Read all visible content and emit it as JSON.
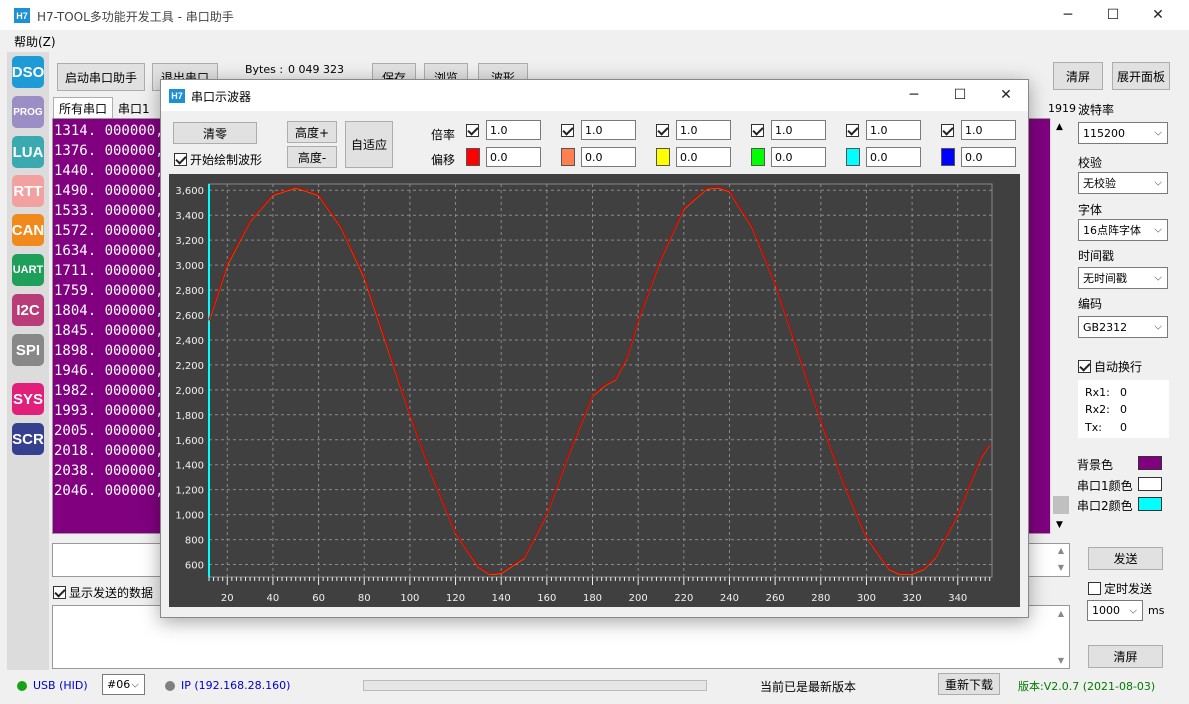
{
  "app": {
    "logo": "H7",
    "title": "H7-TOOL多功能开发工具 - 串口助手",
    "menu": "帮助(Z)"
  },
  "side_icons": [
    {
      "label": "DSO",
      "color": "#1e9ad6",
      "icon": "oscilloscope-icon"
    },
    {
      "label": "PROG",
      "color": "#9b8ec4",
      "icon": "programmer-icon"
    },
    {
      "label": "LUA",
      "color": "#3aa9b0",
      "icon": "lua-icon"
    },
    {
      "label": "RTT",
      "color": "#f2a0a0",
      "icon": "rtt-icon"
    },
    {
      "label": "CAN",
      "color": "#f08a1d",
      "icon": "can-icon"
    },
    {
      "label": "UART",
      "color": "#1ea05a",
      "icon": "uart-icon"
    },
    {
      "label": "I2C",
      "color": "#b83c78",
      "icon": "i2c-icon"
    },
    {
      "label": "SPI",
      "color": "#888888",
      "icon": "spi-icon"
    },
    {
      "label": "SYS",
      "color": "#e0207a",
      "icon": "sys-icon"
    },
    {
      "label": "SCR",
      "color": "#35408f",
      "icon": "scr-icon"
    }
  ],
  "toolbar": {
    "start": "启动串口助手",
    "exit": "退出串口",
    "bytes_label": "Bytes :",
    "bytes_value": "0 049 323",
    "save": "保存",
    "browse": "浏览",
    "wave": "波形",
    "clear": "清屏",
    "expand": "展开面板"
  },
  "tabs": {
    "all": "所有串口",
    "port1": "串口1"
  },
  "receive": {
    "count_right": "1919",
    "lines": [
      "1314. 000000,",
      "1376. 000000,",
      "1440. 000000,",
      "1490. 000000,",
      "1533. 000000,",
      "1572. 000000,",
      "1634. 000000,",
      "1711. 000000,",
      "1759. 000000,",
      "1804. 000000,",
      "1845. 000000,",
      "1898. 000000,",
      "1946. 000000,",
      "1982. 000000,",
      "1993. 000000,",
      "2005. 000000,",
      "2018. 000000,",
      "2038. 000000,",
      "2046. 000000,"
    ]
  },
  "settings": {
    "baud_label": "波特率",
    "baud": "115200",
    "parity_label": "校验",
    "parity": "无校验",
    "font_label": "字体",
    "font": "16点阵字体",
    "timestamp_label": "时间戳",
    "timestamp": "无时间戳",
    "encoding_label": "编码",
    "encoding": "GB2312",
    "autowrap": "自动换行",
    "rx1_label": "Rx1:",
    "rx1": "0",
    "rx2_label": "Rx2:",
    "rx2": "0",
    "tx_label": "Tx:",
    "tx": "0",
    "bg_color_label": "背景色",
    "bg_color": "#800080",
    "port1_color_label": "串口1颜色",
    "port1_color": "#ffffff",
    "port2_color_label": "串口2颜色",
    "port2_color": "#00ffff"
  },
  "send": {
    "send_button": "发送",
    "timed_send": "定时发送",
    "interval": "1000",
    "interval_unit": "ms",
    "show_sent": "显示发送的数据",
    "clear": "清屏"
  },
  "status": {
    "usb": "USB (HID)",
    "device": "#06",
    "ip": "IP (192.168.28.160)",
    "update_msg": "当前已是最新版本",
    "redownload": "重新下载",
    "version": "版本:V2.0.7 (2021-08-03)"
  },
  "scope": {
    "logo": "H7",
    "title": "串口示波器",
    "clear": "清零",
    "height_plus": "高度+",
    "height_minus": "高度-",
    "auto_fit": "自适应",
    "start_draw": "开始绘制波形",
    "scale_label": "倍率",
    "offset_label": "偏移",
    "channels": [
      {
        "scale": "1.0",
        "offset": "0.0",
        "color": "#ff0000"
      },
      {
        "scale": "1.0",
        "offset": "0.0",
        "color": "#ff7f50"
      },
      {
        "scale": "1.0",
        "offset": "0.0",
        "color": "#ffff00"
      },
      {
        "scale": "1.0",
        "offset": "0.0",
        "color": "#00ff00"
      },
      {
        "scale": "1.0",
        "offset": "0.0",
        "color": "#00ffff"
      },
      {
        "scale": "1.0",
        "offset": "0.0",
        "color": "#0000ff"
      }
    ]
  },
  "chart_data": {
    "type": "line",
    "title": "",
    "xlabel": "",
    "ylabel": "",
    "xlim": [
      12,
      355
    ],
    "ylim": [
      500,
      3650
    ],
    "x_ticks": [
      20,
      40,
      60,
      80,
      100,
      120,
      140,
      160,
      180,
      200,
      220,
      240,
      260,
      280,
      300,
      320,
      340
    ],
    "y_ticks": [
      600,
      800,
      1000,
      1200,
      1400,
      1600,
      1800,
      2000,
      2200,
      2400,
      2600,
      2800,
      3000,
      3200,
      3400,
      3600
    ],
    "grid": true,
    "series": [
      {
        "color": "#ff6a00",
        "x": [
          12,
          20,
          30,
          40,
          50,
          60,
          70,
          80,
          90,
          100,
          110,
          120,
          130,
          135,
          140,
          150,
          160,
          170,
          180,
          185,
          190,
          195,
          200,
          210,
          220,
          230,
          235,
          240,
          250,
          260,
          270,
          280,
          290,
          300,
          310,
          315,
          320,
          325,
          330,
          340,
          350,
          354
        ],
        "y": [
          2550,
          3000,
          3350,
          3560,
          3620,
          3560,
          3300,
          2900,
          2350,
          1800,
          1300,
          850,
          580,
          520,
          530,
          650,
          1000,
          1500,
          1950,
          2030,
          2080,
          2250,
          2550,
          3050,
          3450,
          3610,
          3620,
          3590,
          3300,
          2850,
          2300,
          1750,
          1250,
          820,
          560,
          520,
          525,
          560,
          650,
          1000,
          1450,
          1560
        ]
      },
      {
        "color": "#cc0000",
        "x": [
          12,
          20,
          30,
          40,
          50,
          60,
          70,
          80,
          90,
          100,
          110,
          120,
          130,
          135,
          140,
          150,
          160,
          170,
          180,
          185,
          190,
          195,
          200,
          210,
          220,
          230,
          235,
          240,
          250,
          260,
          270,
          280,
          290,
          300,
          310,
          315,
          320,
          325,
          330,
          340,
          350,
          354
        ],
        "y": [
          2560,
          3010,
          3355,
          3565,
          3625,
          3565,
          3305,
          2910,
          2360,
          1805,
          1305,
          855,
          585,
          525,
          535,
          655,
          1005,
          1505,
          1955,
          2035,
          2085,
          2255,
          2555,
          3055,
          3455,
          3615,
          3625,
          3595,
          3305,
          2855,
          2305,
          1755,
          1255,
          825,
          565,
          525,
          530,
          565,
          655,
          1005,
          1455,
          1565
        ]
      }
    ]
  }
}
